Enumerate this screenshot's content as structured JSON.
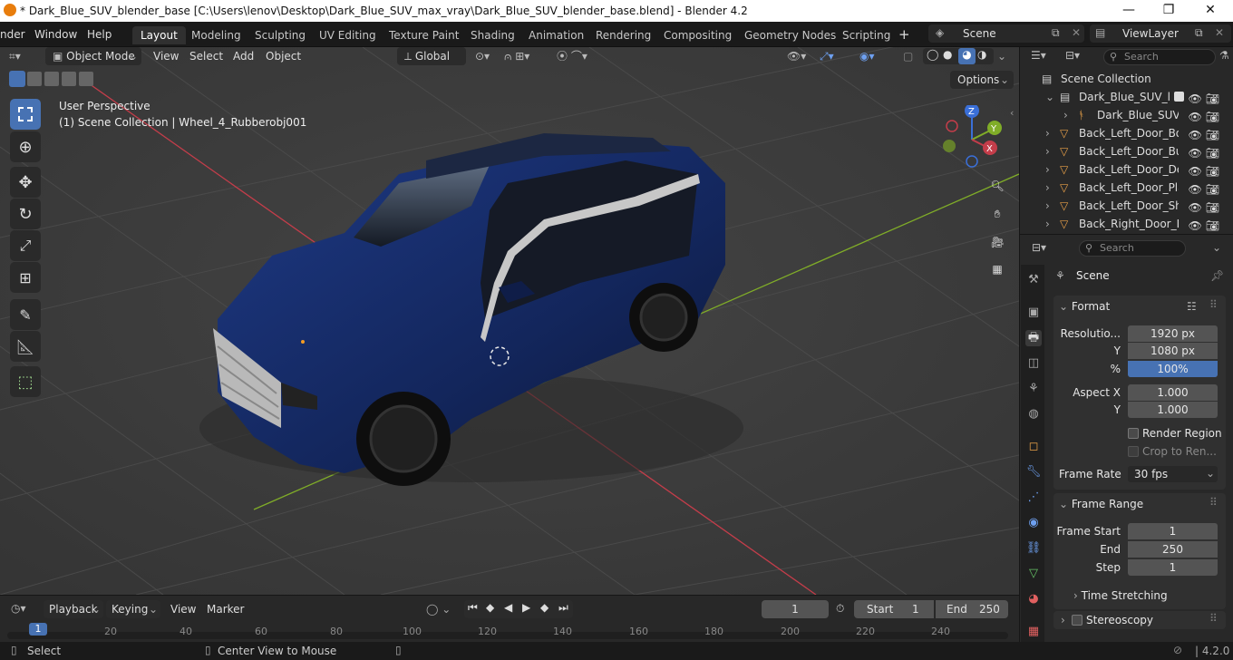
{
  "window": {
    "title": "* Dark_Blue_SUV_blender_base [C:\\Users\\lenov\\Desktop\\Dark_Blue_SUV_max_vray\\Dark_Blue_SUV_blender_base.blend] - Blender 4.2",
    "minimize": "—",
    "maximize": "❐",
    "close": "✕"
  },
  "menu": {
    "items": [
      "nder",
      "Window",
      "Help"
    ],
    "tabs": [
      "Layout",
      "Modeling",
      "Sculpting",
      "UV Editing",
      "Texture Paint",
      "Shading",
      "Animation",
      "Rendering",
      "Compositing",
      "Geometry Nodes",
      "Scripting"
    ],
    "add_tab": "+",
    "scene": "Scene",
    "view_layer": "ViewLayer"
  },
  "viewport": {
    "mode": "Object Mode",
    "menus": [
      "View",
      "Select",
      "Add",
      "Object"
    ],
    "orientation": "Global",
    "options": "Options",
    "perspective": "User Perspective",
    "collection_info": "(1) Scene Collection | Wheel_4_Rubberobj001",
    "gizmo": {
      "x": "X",
      "y": "Y",
      "z": "Z"
    }
  },
  "outliner": {
    "search": "Search",
    "rows": [
      {
        "name": "Scene Collection"
      },
      {
        "name": "Dark_Blue_SUV_lay"
      },
      {
        "name": "Dark_Blue_SUV"
      },
      {
        "name": "Back_Left_Door_Bo"
      },
      {
        "name": "Back_Left_Door_Bu"
      },
      {
        "name": "Back_Left_Door_De"
      },
      {
        "name": "Back_Left_Door_Pla"
      },
      {
        "name": "Back_Left_Door_Sh"
      },
      {
        "name": "Back_Right_Door_B"
      }
    ]
  },
  "properties": {
    "search": "Search",
    "context": "Scene",
    "format": {
      "header": "Format",
      "resolution_label": "Resolutio...",
      "res_x": "1920 px",
      "y_label": "Y",
      "res_y": "1080 px",
      "pct_label": "%",
      "pct": "100%",
      "pct_value": 1.0,
      "aspect_label": "Aspect X",
      "aspect_x": "1.000",
      "aspect_y_label": "Y",
      "aspect_y": "1.000",
      "render_region": "Render Region",
      "crop": "Crop to Ren...",
      "frame_rate_label": "Frame Rate",
      "frame_rate": "30 fps"
    },
    "frame_range": {
      "header": "Frame Range",
      "start_label": "Frame Start",
      "start": "1",
      "end_label": "End",
      "end": "250",
      "step_label": "Step",
      "step": "1",
      "time_stretching": "Time Stretching"
    },
    "stereoscopy": "Stereoscopy"
  },
  "timeline": {
    "menus": [
      "Playback",
      "Keying",
      "View",
      "Marker"
    ],
    "current_frame": "1",
    "start_label": "Start",
    "start": "1",
    "end_label": "End",
    "end": "250",
    "ticks": [
      "1",
      "20",
      "40",
      "60",
      "80",
      "100",
      "120",
      "140",
      "160",
      "180",
      "200",
      "220",
      "240"
    ]
  },
  "status": {
    "select": "Select",
    "center_view": "Center View to Mouse",
    "version": "4.2.0"
  },
  "colors": {
    "accent": "#4772b3",
    "viewport_bg": "#3d3d3d",
    "car_body": "#13265c",
    "x_axis": "#c43d4a",
    "y_axis": "#80ad28"
  }
}
